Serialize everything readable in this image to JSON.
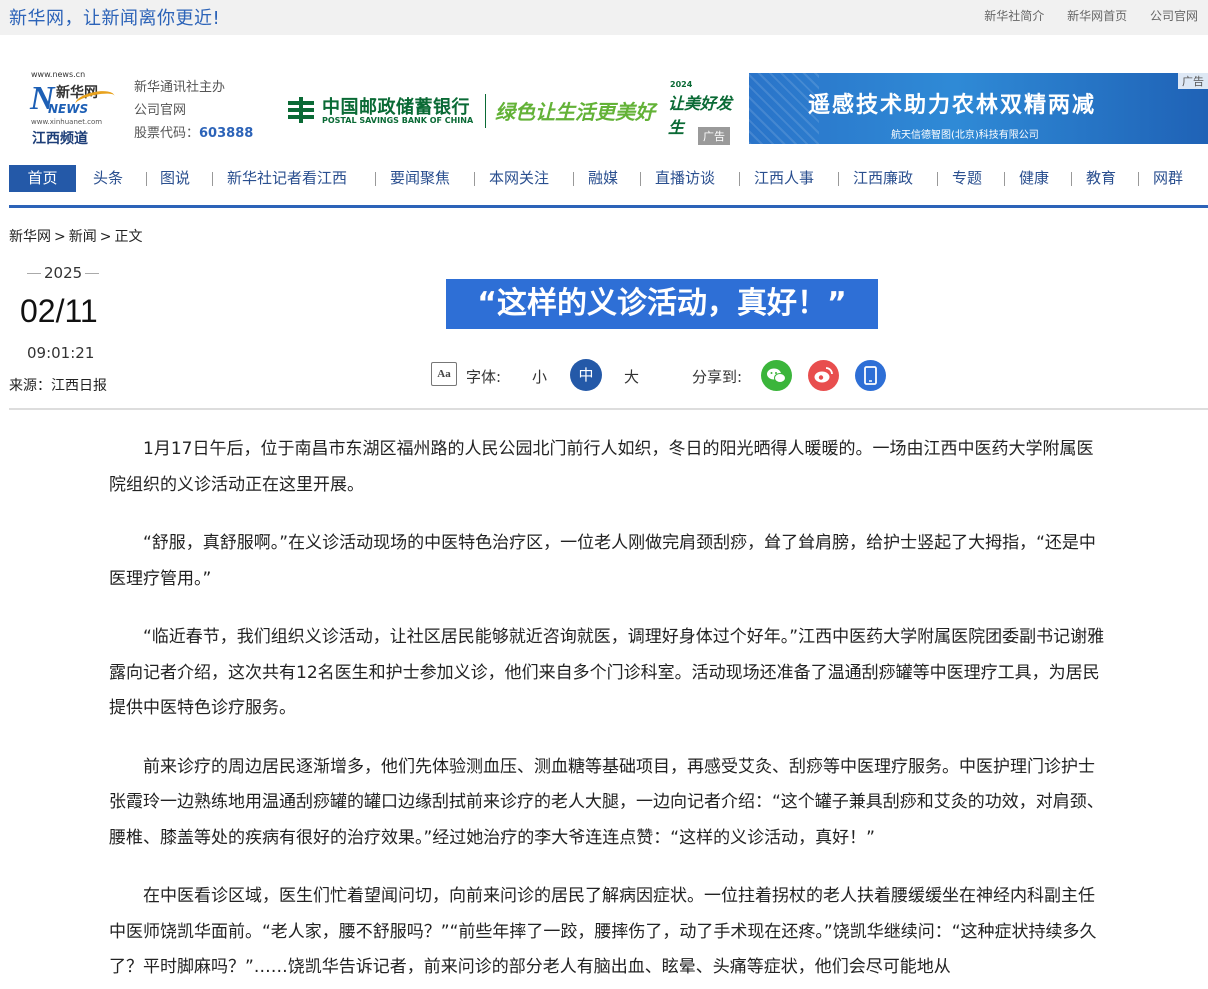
{
  "topbar": {
    "slogan": "新华网，让新闻离你更近!",
    "links": [
      "新华社简介",
      "新华网首页",
      "公司官网"
    ]
  },
  "logo": {
    "url_top": "www.news.cn",
    "brand": "新华网",
    "news_word": "NEWS",
    "url_bottom": "www.xinhuanet.com",
    "channel": "江西频道"
  },
  "sponsor": {
    "line1": "新华通讯社主办",
    "line2": "公司官网",
    "stock_label": "股票代码：",
    "stock_code": "603888"
  },
  "ads": {
    "psbc_cn": "中国邮政储蓄银行",
    "psbc_en": "POSTAL SAVINGS BANK OF CHINA",
    "psbc_slogan": "绿色让生活更美好",
    "psbc_year": "2024",
    "psbc_tag": "让美好发生",
    "ad_label": "广告",
    "remote_title": "遥感技术助力农林双精两减",
    "remote_company": "航天信德智图(北京)科技有限公司"
  },
  "nav": {
    "items": [
      "首页",
      "头条",
      "图说",
      "新华社记者看江西",
      "要闻聚焦",
      "本网关注",
      "融媒",
      "直播访谈",
      "江西人事",
      "江西廉政",
      "专题",
      "健康",
      "教育",
      "网群"
    ]
  },
  "breadcrumb": [
    "新华网",
    "新闻",
    "正文"
  ],
  "meta": {
    "year": "2025",
    "date": "02/11",
    "time": "09:01:21",
    "source": "来源：江西日报"
  },
  "headline": "“这样的义诊活动，真好！”",
  "tools": {
    "font_icon": "Aa",
    "font_label": "字体:",
    "sizes": [
      "小",
      "中",
      "大"
    ],
    "share_label": "分享到:"
  },
  "colors": {
    "brand_blue": "#2c63b8",
    "nav_active": "#2459a8",
    "headline_bg": "#2e6fd6",
    "wechat": "#3bb53b",
    "weibo": "#e84e4e"
  },
  "article": {
    "paragraphs": [
      "1月17日午后，位于南昌市东湖区福州路的人民公园北门前行人如织，冬日的阳光晒得人暖暖的。一场由江西中医药大学附属医院组织的义诊活动正在这里开展。",
      "“舒服，真舒服啊。”在义诊活动现场的中医特色治疗区，一位老人刚做完肩颈刮痧，耸了耸肩膀，给护士竖起了大拇指，“还是中医理疗管用。”",
      "“临近春节，我们组织义诊活动，让社区居民能够就近咨询就医，调理好身体过个好年。”江西中医药大学附属医院团委副书记谢雅露向记者介绍，这次共有12名医生和护士参加义诊，他们来自多个门诊科室。活动现场还准备了温通刮痧罐等中医理疗工具，为居民提供中医特色诊疗服务。",
      "前来诊疗的周边居民逐渐增多，他们先体验测血压、测血糖等基础项目，再感受艾灸、刮痧等中医理疗服务。中医护理门诊护士张霞玲一边熟练地用温通刮痧罐的罐口边缘刮拭前来诊疗的老人大腿，一边向记者介绍：“这个罐子兼具刮痧和艾灸的功效，对肩颈、腰椎、膝盖等处的疾病有很好的治疗效果。”经过她治疗的李大爷连连点赞：“这样的义诊活动，真好！”",
      "在中医看诊区域，医生们忙着望闻问切，向前来问诊的居民了解病因症状。一位拄着拐杖的老人扶着腰缓缓坐在神经内科副主任中医师饶凯华面前。“老人家，腰不舒服吗？”“前些年摔了一跤，腰摔伤了，动了手术现在还疼。”饶凯华继续问：“这种症状持续多久了？平时脚麻吗？”……饶凯华告诉记者，前来问诊的部分老人有脑出血、眩晕、头痛等症状，他们会尽可能地从"
    ]
  }
}
